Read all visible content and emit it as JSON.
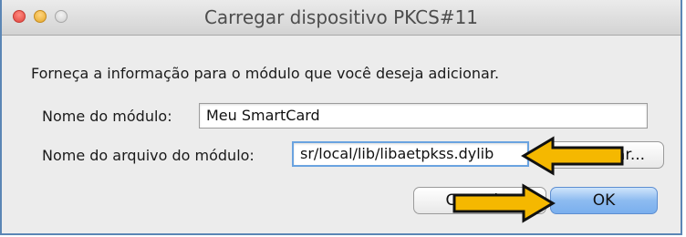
{
  "window": {
    "title": "Carregar dispositivo PKCS#11"
  },
  "dialog": {
    "prompt": "Forneça a informação para o módulo que você deseja adicionar.",
    "module_name_label": "Nome do módulo:",
    "module_name_value": "Meu SmartCard",
    "module_file_label": "Nome do arquivo do módulo:",
    "module_file_value": "sr/local/lib/libaetpkss.dylib",
    "browse_button_label": "Procurar...",
    "cancel_button_label": "Cancelar",
    "ok_button_label": "OK"
  },
  "annotations": {
    "arrow_color": "#f5b800",
    "arrow_outline": "#111111"
  }
}
